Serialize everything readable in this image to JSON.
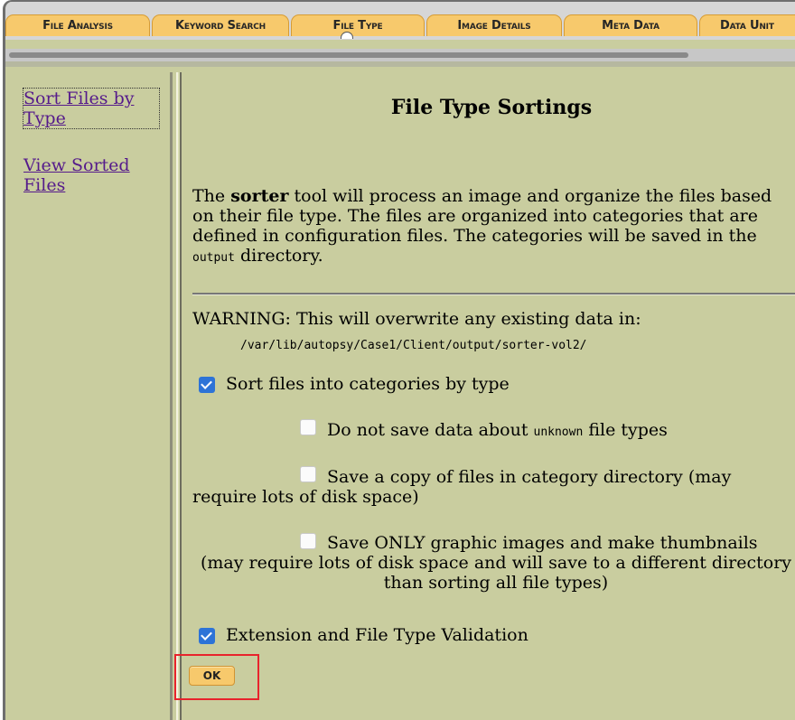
{
  "tabs": [
    {
      "label": "File Analysis"
    },
    {
      "label": "Keyword Search"
    },
    {
      "label": "File Type"
    },
    {
      "label": "Image Details"
    },
    {
      "label": "Meta Data"
    },
    {
      "label": "Data Unit"
    }
  ],
  "nav": {
    "sort_files_by_type": "Sort Files by Type",
    "view_sorted_files": "View Sorted Files"
  },
  "main": {
    "title": "File Type Sortings",
    "intro_before": "The ",
    "intro_bold": "sorter",
    "intro_mid": " tool will process an image and organize the files based on their file type. The files are organized into categories that are defined in configuration files. The categories will be saved in the ",
    "intro_code": "output",
    "intro_after": " directory.",
    "warning": "WARNING: This will overwrite any existing data in:",
    "warning_path": "/var/lib/autopsy/Case1/Client/output/sorter-vol2/",
    "options": [
      {
        "label": "Sort files into categories by type",
        "checked": true
      },
      {
        "label_before": "Do not save data about ",
        "label_code": "unknown",
        "label_after": " file types",
        "checked": false
      },
      {
        "label": "Save a copy of files in category directory (may require lots of disk space)",
        "checked": false
      },
      {
        "label_first": "Save ONLY graphic images and make thumbnails",
        "label_rest": "(may require lots of disk space and will save to a different directory than sorting all file types)",
        "checked": false
      },
      {
        "label": "Extension and File Type Validation",
        "checked": true
      }
    ],
    "ok_label": "OK"
  },
  "colors": {
    "background": "#c9cd9f",
    "tab": "#f7c96c",
    "checkbox_checked": "#2d73d7",
    "link": "#551a8b",
    "highlight": "#e8232c"
  }
}
